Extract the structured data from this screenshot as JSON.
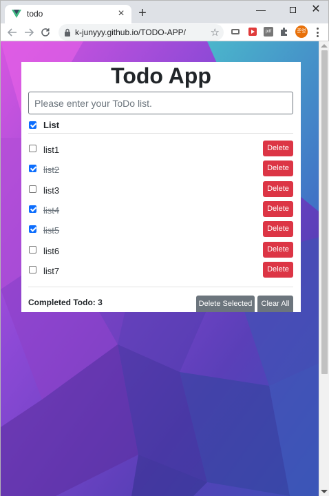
{
  "browser": {
    "tab_title": "todo",
    "url": "k-junyyy.github.io/TODO-APP/",
    "avatar_text": "준영",
    "ext_badge_text": "pdf"
  },
  "app": {
    "title": "Todo App",
    "input_placeholder": "Please enter your ToDo list.",
    "header_label": "List",
    "header_checked": true,
    "delete_label": "Delete",
    "completed_label": "Completed Todo: 3",
    "delete_selected_label": "Delete Selected",
    "clear_all_label": "Clear All",
    "items": [
      {
        "label": "list1",
        "done": false
      },
      {
        "label": "list2",
        "done": true
      },
      {
        "label": "list3",
        "done": false
      },
      {
        "label": "list4",
        "done": true
      },
      {
        "label": "list5",
        "done": true
      },
      {
        "label": "list6",
        "done": false
      },
      {
        "label": "list7",
        "done": false
      }
    ]
  },
  "colors": {
    "danger": "#dc3545",
    "secondary": "#6c757d",
    "primary": "#0d6efd"
  }
}
